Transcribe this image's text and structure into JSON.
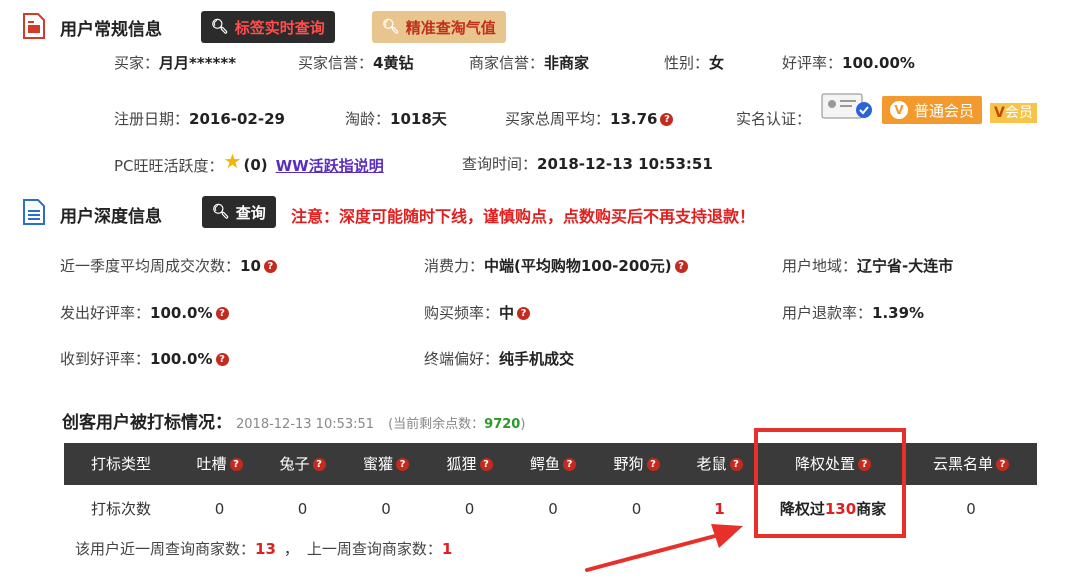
{
  "section1": {
    "title": "用户常规信息",
    "btn_tag": "标签实时查询",
    "btn_precise": "精准查淘气值"
  },
  "basic": {
    "buyer_label": "买家：",
    "buyer_value": "月月******",
    "buyer_credit_label": "买家信誉：",
    "buyer_credit_value": "4黄钻",
    "seller_credit_label": "商家信誉：",
    "seller_credit_value": "非商家",
    "gender_label": "性别：",
    "gender_value": "女",
    "rate_label": "好评率：",
    "rate_value": "100.00%",
    "reg_label": "注册日期：",
    "reg_value": "2016-02-29",
    "age_label": "淘龄：",
    "age_value": "1018天",
    "weekly_label": "买家总周平均：",
    "weekly_value": "13.76",
    "realname_label": "实名认证：",
    "member_badge": "普通会员",
    "member_badge2": "会员",
    "ww_label": "PC旺旺活跃度：",
    "ww_value": "(0)",
    "ww_link": "WW活跃指说明",
    "query_time_label": "查询时间：",
    "query_time_value": "2018-12-13 10:53:51"
  },
  "section2": {
    "title": "用户深度信息",
    "btn_query": "查询",
    "warning": "注意：深度可能随时下线，谨慎购点，点数购买后不再支持退款！"
  },
  "deep": {
    "trade_label": "近一季度平均周成交次数：",
    "trade_value": "10",
    "consume_label": "消费力：",
    "consume_value": "中端(平均购物100-200元)",
    "region_label": "用户地域：",
    "region_value": "辽宁省-大连市",
    "send_rate_label": "发出好评率：",
    "send_rate_value": "100.0%",
    "freq_label": "购买频率：",
    "freq_value": "中",
    "refund_label": "用户退款率：",
    "refund_value": "1.39%",
    "recv_rate_label": "收到好评率：",
    "recv_rate_value": "100.0%",
    "device_label": "终端偏好：",
    "device_value": "纯手机成交"
  },
  "mark": {
    "title": "创客用户被打标情况：",
    "time": "2018-12-13 10:53:51",
    "remain_prefix": "(当前剩余点数：",
    "remain_value": "9720",
    "remain_suffix": ")",
    "headers": [
      "打标类型",
      "吐槽",
      "兔子",
      "蜜獾",
      "狐狸",
      "鳄鱼",
      "野狗",
      "老鼠",
      "降权处置",
      "云黑名单"
    ],
    "row_label": "打标次数",
    "row_values": [
      "0",
      "0",
      "0",
      "0",
      "0",
      "0",
      "1",
      "",
      "0"
    ],
    "demote_prefix": "降权过",
    "demote_value": "130",
    "demote_suffix": "商家",
    "week_label": "该用户近一周查询商家数：",
    "week_value": "13",
    "sep": "，",
    "lastweek_label": "上一周查询商家数：",
    "lastweek_value": "1"
  },
  "colors": {
    "accent_red": "#e02020",
    "dark_bar": "#3a3a3a",
    "gold_button": "#e8c58f",
    "member_orange": "#f29a2e"
  }
}
